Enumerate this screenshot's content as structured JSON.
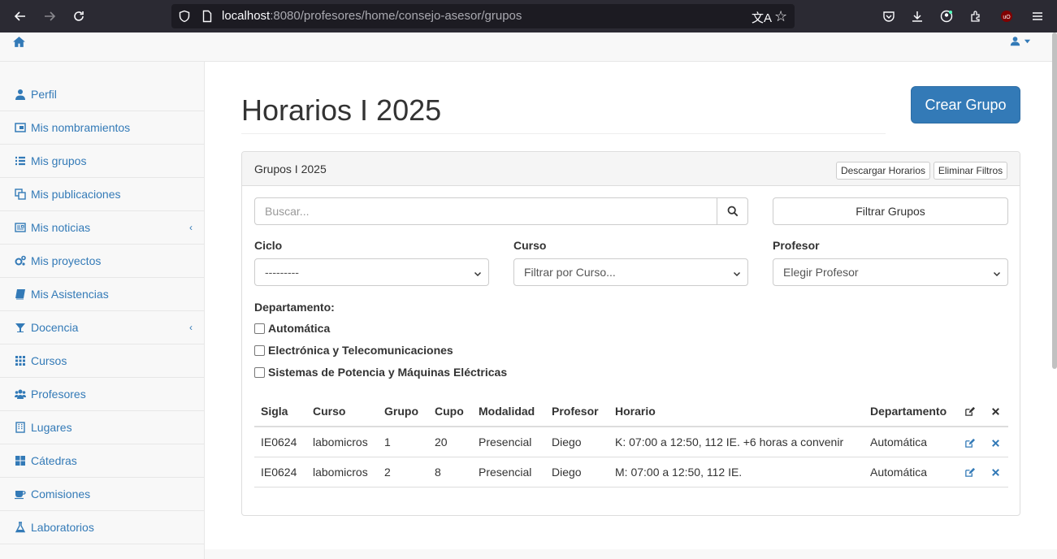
{
  "browser": {
    "url_host": "localhost",
    "url_rest": ":8080/profesores/home/consejo-asesor/grupos"
  },
  "sidebar": {
    "items": [
      {
        "label": "Perfil",
        "icon": "user-icon"
      },
      {
        "label": "Mis nombramientos",
        "icon": "card-icon"
      },
      {
        "label": "Mis grupos",
        "icon": "list-icon"
      },
      {
        "label": "Mis publicaciones",
        "icon": "copy-icon"
      },
      {
        "label": "Mis noticias",
        "icon": "newspaper-icon",
        "chevron": "‹"
      },
      {
        "label": "Mis proyectos",
        "icon": "cogs-icon"
      },
      {
        "label": "Mis Asistencias",
        "icon": "book-icon"
      },
      {
        "label": "Docencia",
        "icon": "glass-icon",
        "chevron": "‹"
      },
      {
        "label": "Cursos",
        "icon": "grid-icon"
      },
      {
        "label": "Profesores",
        "icon": "users-icon"
      },
      {
        "label": "Lugares",
        "icon": "building-icon"
      },
      {
        "label": "Cátedras",
        "icon": "th-large-icon"
      },
      {
        "label": "Comisiones",
        "icon": "coffee-icon"
      },
      {
        "label": "Laboratorios",
        "icon": "flask-icon"
      }
    ]
  },
  "main": {
    "title": "Horarios I 2025",
    "create_button": "Crear Grupo",
    "panel_title": "Grupos I 2025",
    "download_button": "Descargar Horarios",
    "clear_filters_button": "Eliminar Filtros",
    "search_placeholder": "Buscar...",
    "filter_button": "Filtrar Grupos",
    "ciclo_label": "Ciclo",
    "ciclo_value": "---------",
    "curso_label": "Curso",
    "curso_value": "Filtrar por Curso...",
    "profesor_label": "Profesor",
    "profesor_value": "Elegir Profesor",
    "departamento_label": "Departamento:",
    "departamentos": [
      "Automática",
      "Electrónica y Telecomunicaciones",
      "Sistemas de Potencia y Máquinas Eléctricas"
    ]
  },
  "table": {
    "headers": [
      "Sigla",
      "Curso",
      "Grupo",
      "Cupo",
      "Modalidad",
      "Profesor",
      "Horario",
      "Departamento"
    ],
    "rows": [
      [
        "IE0624",
        "labomicros",
        "1",
        "20",
        "Presencial",
        "Diego",
        "K: 07:00 a 12:50, 112 IE. +6 horas a convenir",
        "Automática"
      ],
      [
        "IE0624",
        "labomicros",
        "2",
        "8",
        "Presencial",
        "Diego",
        "M: 07:00 a 12:50, 112 IE.",
        "Automática"
      ]
    ]
  }
}
